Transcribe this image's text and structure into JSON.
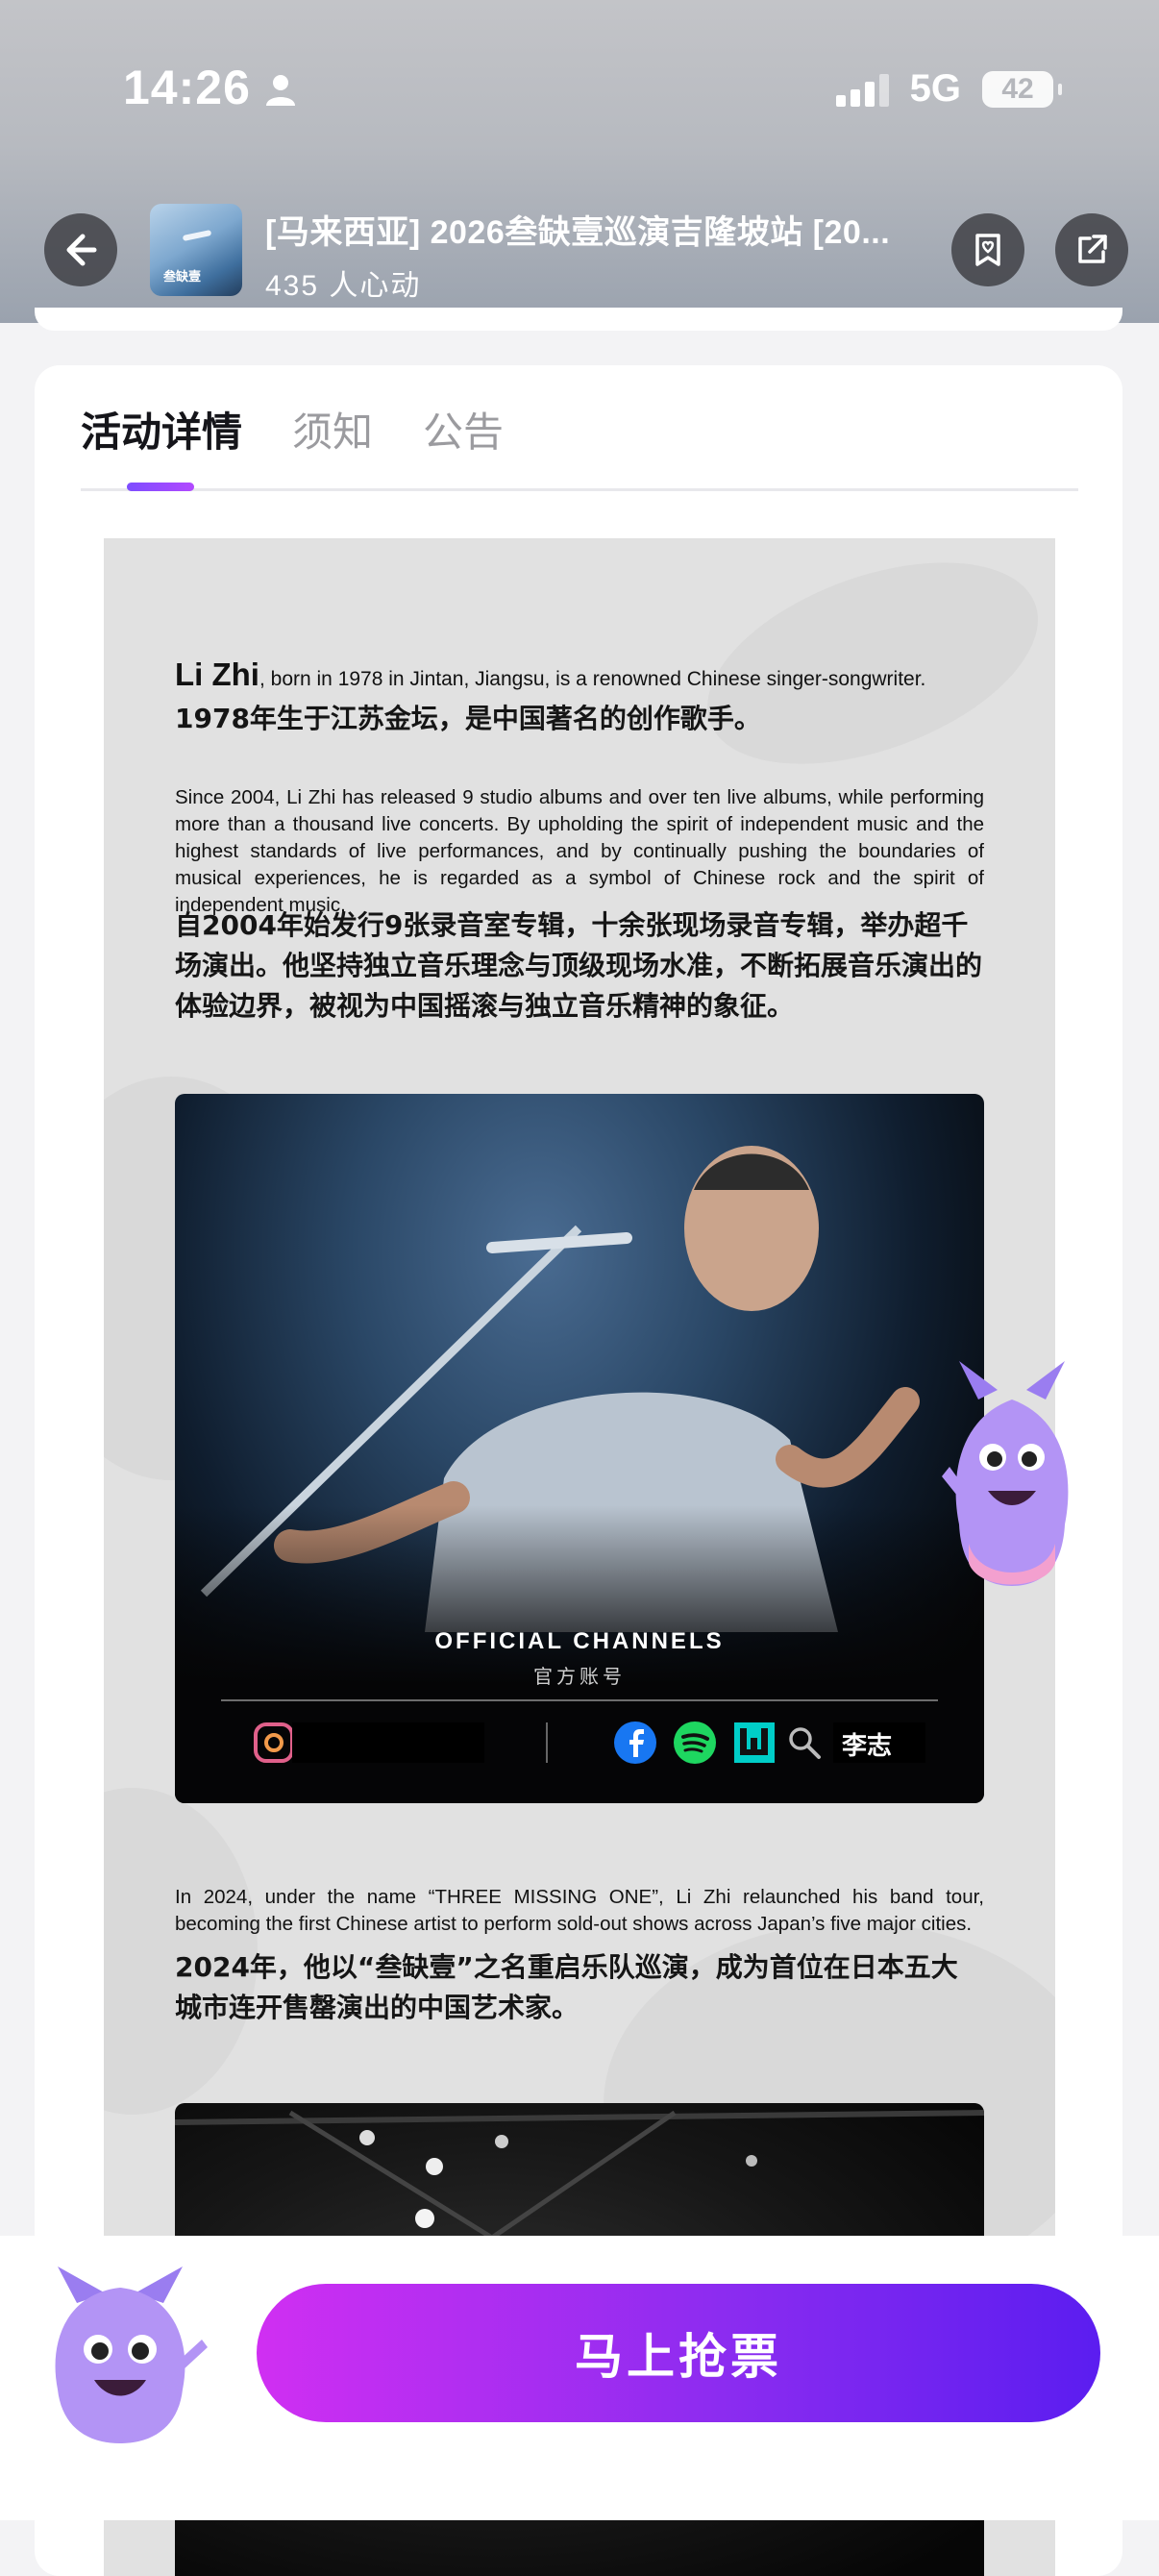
{
  "status_bar": {
    "time": "14:26",
    "network": "5G",
    "battery": "42"
  },
  "header": {
    "title": "[马来西亚] 2026叁缺壹巡演吉隆坡站 [20...",
    "subtitle": "435 人心动",
    "thumbnail_label": "叁缺壹"
  },
  "tabs": [
    {
      "label": "活动详情",
      "active": true
    },
    {
      "label": "须知",
      "active": false
    },
    {
      "label": "公告",
      "active": false
    }
  ],
  "poster": {
    "intro_name": "Li Zhi",
    "intro_en": ", born in 1978 in Jintan, Jiangsu, is a renowned Chinese singer-songwriter.",
    "intro_cn": "1978年生于江苏金坛，是中国著名的创作歌手。",
    "para1_en": "Since 2004, Li Zhi has released 9 studio albums and over ten live albums, while performing more than a thousand live concerts. By upholding the spirit of independent music and the highest standards of live performances, and by continually pushing the boundaries of musical experiences, he is regarded as a symbol of Chinese rock and the spirit of independent music.",
    "para1_cn": "自2004年始发行9张录音室专辑，十余张现场录音专辑，举办超千场演出。他坚持独立音乐理念与顶级现场水准，不断拓展音乐演出的体验边界，被视为中国摇滚与独立音乐精神的象征。",
    "channels_title": "OFFICIAL CHANNELS",
    "channels_sub": "官方账号",
    "channels_search_name": "李志",
    "para2_en": "In 2024, under the name “THREE MISSING ONE”, Li Zhi relaunched his band tour, becoming the first Chinese artist to perform sold-out shows across Japan’s five major cities.",
    "para2_cn": "2024年，他以“叁缺壹”之名重启乐队巡演，成为首位在日本五大城市连开售罄演出的中国艺术家。"
  },
  "cta": {
    "buy_label": "马上抢票"
  },
  "colors": {
    "accent_start": "#d02ff2",
    "accent_end": "#5b1df0",
    "tab_indicator": "#8c4dff"
  }
}
